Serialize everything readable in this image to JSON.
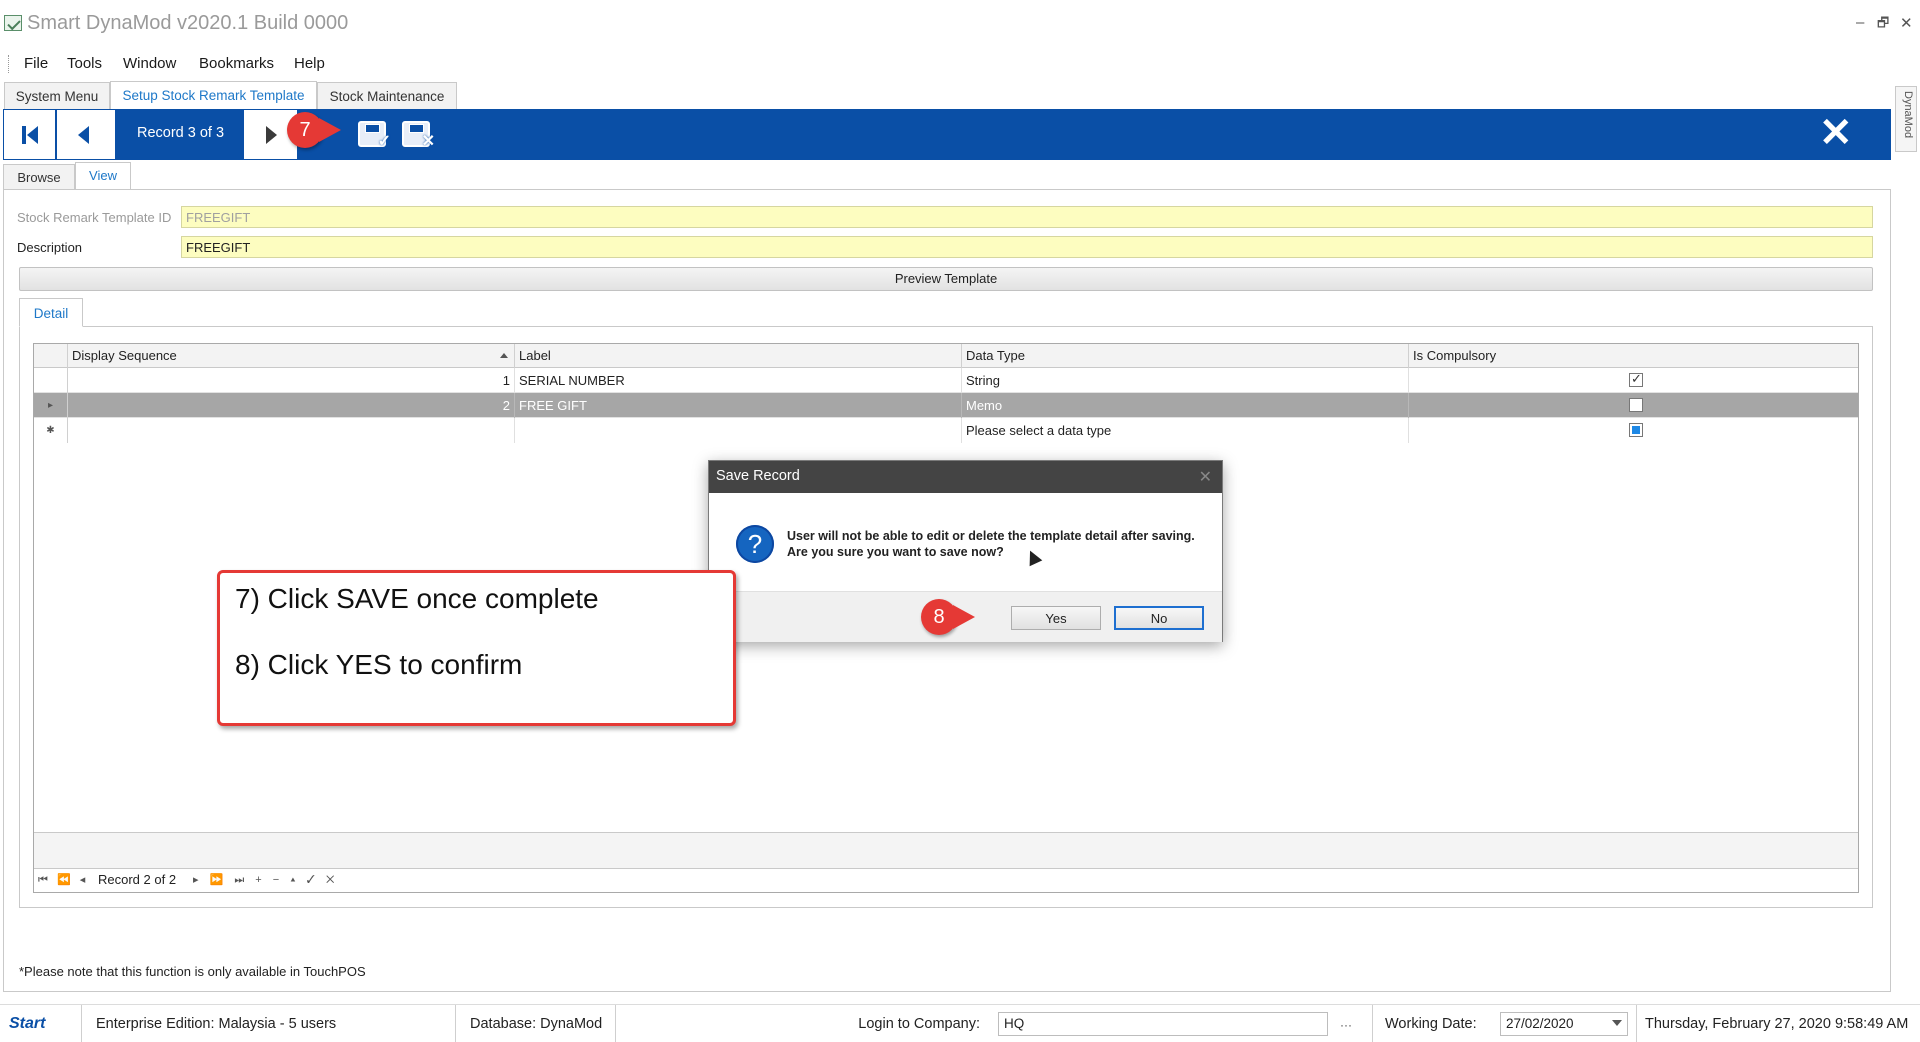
{
  "window": {
    "title": "Smart DynaMod v2020.1 Build 0000",
    "controls": [
      "–",
      "🗗",
      "✕"
    ]
  },
  "menu": [
    "File",
    "Tools",
    "Window",
    "Bookmarks",
    "Help"
  ],
  "main_tabs": [
    "System Menu",
    "Setup Stock Remark Template",
    "Stock Maintenance"
  ],
  "side_tab": "DynaMod",
  "navigator": {
    "record_label": "Record 3 of 3",
    "step_badge": "7",
    "close": "✕"
  },
  "sub_tabs": [
    "Browse",
    "View"
  ],
  "form": {
    "template_id_label": "Stock Remark Template ID",
    "template_id_value": "FREEGIFT",
    "description_label": "Description",
    "description_value": "FREEGIFT",
    "preview_button": "Preview Template"
  },
  "detail_tab": "Detail",
  "grid": {
    "columns": [
      "Display Sequence",
      "Label",
      "Data Type",
      "Is Compulsory"
    ],
    "rows": [
      {
        "indicator": "",
        "seq": "1",
        "label": "SERIAL NUMBER",
        "type": "String",
        "compulsory": "checked"
      },
      {
        "indicator": "▸",
        "seq": "2",
        "label": "FREE GIFT",
        "type": "Memo",
        "compulsory": "unchecked"
      },
      {
        "indicator": "✱",
        "seq": "",
        "label": "",
        "type": "Please select a data type",
        "compulsory": "indeterminate"
      }
    ],
    "nav_left_icons": "⏮ ⏪ ◂",
    "nav_record": "Record 2 of 2",
    "nav_right_icons": "▸ ⏩ ⏭ + − ▴ ✓ ✕"
  },
  "note": "*Please note that this function is only available in TouchPOS",
  "status": {
    "brand": "Start",
    "edition": "Enterprise Edition: Malaysia - 5 users",
    "database": "Database: DynaMod",
    "login_label": "Login to Company:",
    "login_value": "HQ",
    "login_more": "···",
    "working_date_label": "Working Date:",
    "working_date_value": "27/02/2020",
    "datetime": "Thursday, February 27, 2020 9:58:49 AM"
  },
  "dialog": {
    "title": "Save Record",
    "message": "User will not be able to edit or delete the template detail after saving. Are you sure you want to save now?",
    "icon": "?",
    "yes": "Yes",
    "no": "No",
    "step_badge": "8"
  },
  "callout": {
    "line1": "7) Click SAVE once complete",
    "line2": "8) Click YES to confirm"
  },
  "colors": {
    "accent_blue": "#0a4fa6",
    "tab_text": "#1e78c8",
    "badge_red": "#e53935",
    "field_yellow": "#fdfdc0"
  }
}
